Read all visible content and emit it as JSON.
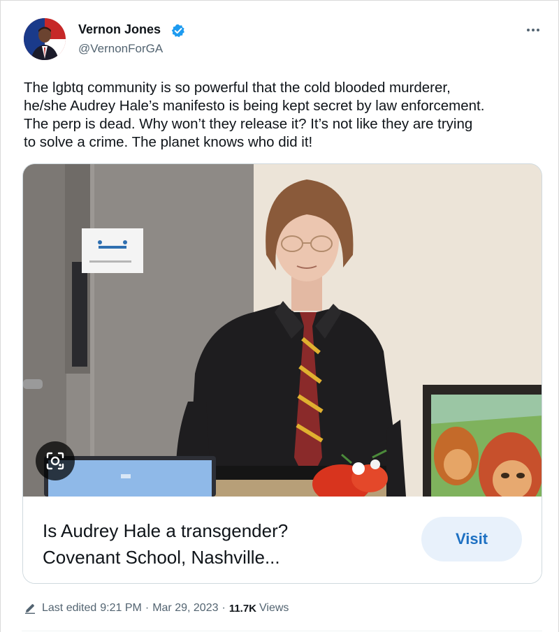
{
  "author": {
    "name": "Vernon Jones",
    "handle": "@VernonForGA",
    "verified": true
  },
  "tweet": {
    "text": "The lgbtq community is so powerful that the cold blooded murderer,\nhe/she Audrey Hale’s manifesto is being kept secret by law enforcement.\nThe perp is dead.  Why won’t they release it?  It’s not like they are trying\nto solve a crime.  The planet knows who did it!"
  },
  "card": {
    "title_line1": "Is Audrey Hale a transgender?",
    "title_line2": "Covenant School, Nashville...",
    "visit_label": "Visit"
  },
  "meta": {
    "edited_label": "Last edited",
    "time": "9:21 PM",
    "date": "Mar 29, 2023",
    "separator": "·",
    "views_count": "11.7K",
    "views_label": "Views"
  },
  "colors": {
    "accent": "#1d9bf0",
    "secondary_text": "#536471",
    "visit_bg": "#e8f1fb",
    "visit_text": "#1d70c2"
  },
  "icons": {
    "verified": "verified-badge-icon",
    "more": "more-icon",
    "lens": "lens-icon",
    "edit": "pencil-icon"
  }
}
